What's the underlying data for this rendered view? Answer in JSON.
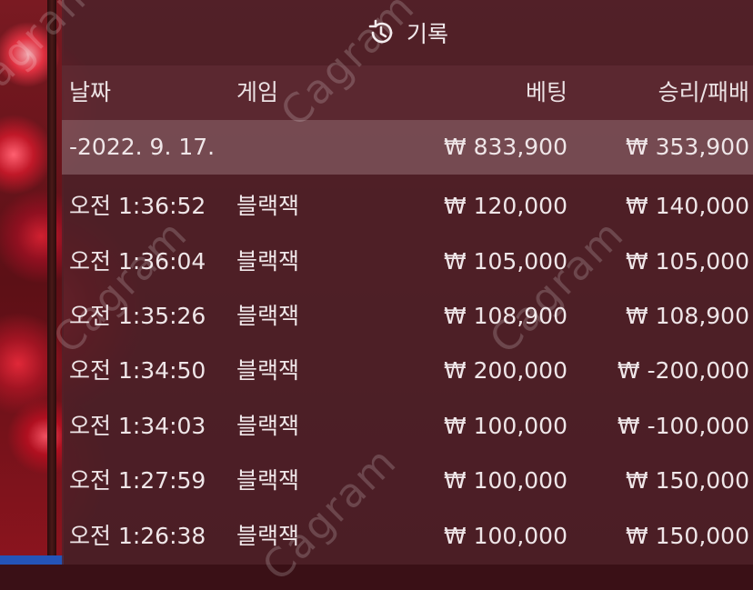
{
  "header": {
    "title": "기록",
    "icon": "history-icon"
  },
  "columns": {
    "date": "날짜",
    "game": "게임",
    "bet": "베팅",
    "win_loss": "승리/패배"
  },
  "summary": {
    "date": "-2022. 9. 17.",
    "bet": "₩ 833,900",
    "win_loss": "₩ 353,900"
  },
  "rows": [
    {
      "time": "오전 1:36:52",
      "game": "블랙잭",
      "bet": "₩ 120,000",
      "win_loss": "₩ 140,000"
    },
    {
      "time": "오전 1:36:04",
      "game": "블랙잭",
      "bet": "₩ 105,000",
      "win_loss": "₩ 105,000"
    },
    {
      "time": "오전 1:35:26",
      "game": "블랙잭",
      "bet": "₩ 108,900",
      "win_loss": "₩ 108,900"
    },
    {
      "time": "오전 1:34:50",
      "game": "블랙잭",
      "bet": "₩ 200,000",
      "win_loss": "₩ -200,000"
    },
    {
      "time": "오전 1:34:03",
      "game": "블랙잭",
      "bet": "₩ 100,000",
      "win_loss": "₩ -100,000"
    },
    {
      "time": "오전 1:27:59",
      "game": "블랙잭",
      "bet": "₩ 100,000",
      "win_loss": "₩ 150,000"
    },
    {
      "time": "오전 1:26:38",
      "game": "블랙잭",
      "bet": "₩ 100,000",
      "win_loss": "₩ 150,000"
    }
  ],
  "watermark": "Cagram"
}
